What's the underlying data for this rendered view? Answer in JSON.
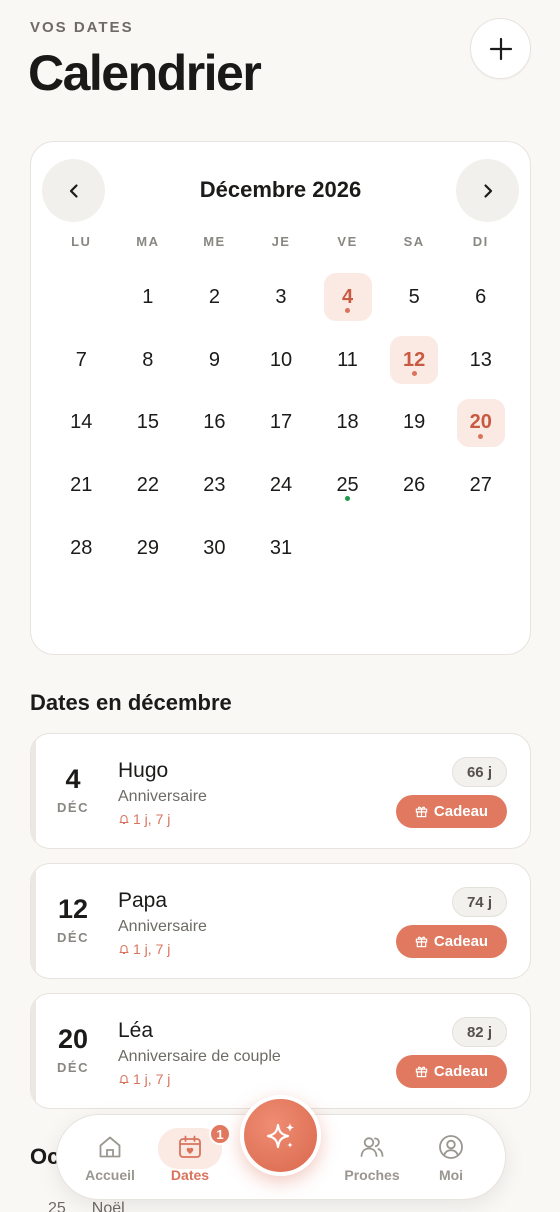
{
  "header": {
    "eyebrow": "VOS DATES",
    "title": "Calendrier",
    "add_icon": "plus-icon"
  },
  "calendar": {
    "month_label": "Décembre 2026",
    "weekdays": [
      "LU",
      "MA",
      "ME",
      "JE",
      "VE",
      "SA",
      "DI"
    ],
    "days": [
      {
        "label": ""
      },
      {
        "label": "1"
      },
      {
        "label": "2"
      },
      {
        "label": "3"
      },
      {
        "label": "4",
        "event": true,
        "dot": "accent"
      },
      {
        "label": "5"
      },
      {
        "label": "6"
      },
      {
        "label": "7"
      },
      {
        "label": "8"
      },
      {
        "label": "9"
      },
      {
        "label": "10"
      },
      {
        "label": "11"
      },
      {
        "label": "12",
        "event": true,
        "dot": "accent"
      },
      {
        "label": "13"
      },
      {
        "label": "14"
      },
      {
        "label": "15"
      },
      {
        "label": "16"
      },
      {
        "label": "17"
      },
      {
        "label": "18"
      },
      {
        "label": "19"
      },
      {
        "label": "20",
        "event": true,
        "dot": "accent"
      },
      {
        "label": "21"
      },
      {
        "label": "22"
      },
      {
        "label": "23"
      },
      {
        "label": "24"
      },
      {
        "label": "25",
        "dot": "green"
      },
      {
        "label": "26"
      },
      {
        "label": "27"
      },
      {
        "label": "28"
      },
      {
        "label": "29"
      },
      {
        "label": "30"
      },
      {
        "label": "31"
      }
    ]
  },
  "month_section": {
    "title": "Dates en décembre",
    "events": [
      {
        "day": "4",
        "month": "DÉC",
        "name": "Hugo",
        "type": "Anniversaire",
        "reminder": "1 j, 7 j",
        "countdown": "66 j",
        "gift_label": "Cadeau"
      },
      {
        "day": "12",
        "month": "DÉC",
        "name": "Papa",
        "type": "Anniversaire",
        "reminder": "1 j, 7 j",
        "countdown": "74 j",
        "gift_label": "Cadeau"
      },
      {
        "day": "20",
        "month": "DÉC",
        "name": "Léa",
        "type": "Anniversaire de couple",
        "reminder": "1 j, 7 j",
        "countdown": "82 j",
        "gift_label": "Cadeau"
      }
    ]
  },
  "next_section": {
    "title": "Oc",
    "row_day": "25",
    "row_name": "Noël"
  },
  "bottom_nav": {
    "items": [
      {
        "label": "Accueil",
        "icon": "home-icon"
      },
      {
        "label": "Dates",
        "icon": "calendar-heart-icon",
        "badge": "1",
        "active": true
      },
      {
        "label": "Proches",
        "icon": "people-icon"
      },
      {
        "label": "Moi",
        "icon": "user-icon"
      }
    ],
    "fab_icon": "sparkles-icon"
  },
  "colors": {
    "accent": "#e0795f",
    "accent_soft": "#fbe9e3",
    "holiday_dot": "#1f9a4b",
    "background": "#faf8f5"
  }
}
